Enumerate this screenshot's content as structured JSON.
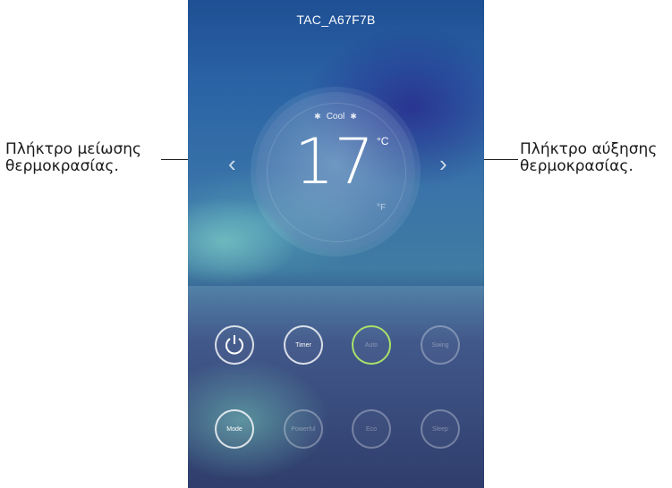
{
  "device": {
    "name": "TAC_A67F7B"
  },
  "mode": {
    "label": "Cool",
    "decor_icon": "snowflake-icon"
  },
  "temperature": {
    "value": "17",
    "unit_c": "°C",
    "unit_f": "°F"
  },
  "arrows": {
    "decrease": "‹",
    "increase": "›"
  },
  "annotations": {
    "left": "Πλήκτρο μείωσης\nθερμοκρασίας.",
    "right": "Πλήκτρο αύξησης\nθερμοκρασίας."
  },
  "buttons": {
    "row1": [
      "",
      "Timer",
      "Auto",
      "Swing"
    ],
    "row2": [
      "Mode",
      "Powerful",
      "Eco",
      "Sleep"
    ]
  },
  "colors": {
    "accent_green": "#a8e06a"
  }
}
